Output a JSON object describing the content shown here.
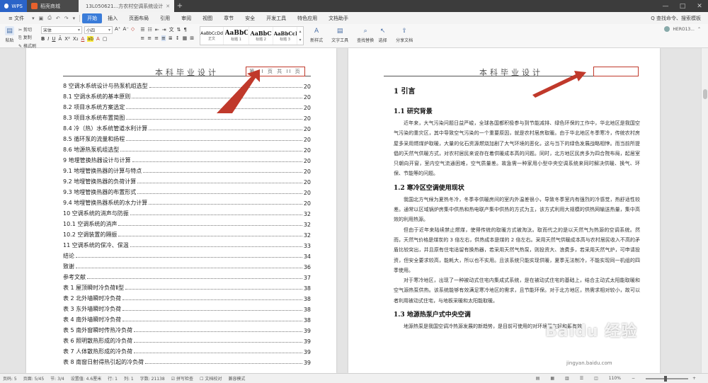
{
  "titlebar": {
    "tabs": [
      {
        "label": "WPS"
      },
      {
        "label": "稻壳商城"
      },
      {
        "label": "13L050621...方农村空调系统设计"
      }
    ],
    "add": "+",
    "controls": [
      "—",
      "□",
      "✕"
    ]
  },
  "menubar": {
    "file": "≡ 文件",
    "quick": [
      "▾",
      "▣",
      "⎙",
      "↶",
      "↷",
      "▾"
    ],
    "items": [
      "开始",
      "插入",
      "页面布局",
      "引用",
      "审阅",
      "视图",
      "章节",
      "安全",
      "开发工具",
      "特色应用",
      "文档助手"
    ],
    "active": "开始",
    "search": "Q 查找命令、搜索模板"
  },
  "ribbon": {
    "paste": "粘贴",
    "cut": "剪切",
    "copy": "复制",
    "format_painter": "格式刷",
    "font_name": "宋体",
    "font_size": "小四",
    "styles": [
      {
        "sample": "AaBbCcDd",
        "label": "正文"
      },
      {
        "sample": "AaBbC",
        "label": "标题 1"
      },
      {
        "sample": "AaBbC",
        "label": "标题 2"
      },
      {
        "sample": "AaBbCcI",
        "label": "标题 3"
      }
    ],
    "new_style": "新样式",
    "text_tools": "文字工具",
    "find_replace": "查找替换",
    "select": "选择",
    "share": "分享文档",
    "user": "HERO13..."
  },
  "left_page": {
    "header_title": "本科毕业设计",
    "page_box": "第 II 页 共 II 页",
    "toc": [
      {
        "text": "8  空调水系统设计与热泵机组选型",
        "page": "20"
      },
      {
        "text": "8.1  空调水系统的基本原则",
        "page": "20"
      },
      {
        "text": "8.2  项目水系统方案选定",
        "page": "20"
      },
      {
        "text": "8.3  项目水系统布置简图",
        "page": "20"
      },
      {
        "text": "8.4  冷（热）水系统管道水利计算",
        "page": "20"
      },
      {
        "text": "8.5  循环泵的流量和扬程",
        "page": "20"
      },
      {
        "text": "8.6  地源热泵机组选型",
        "page": "20"
      },
      {
        "text": "9  地埋管换热器设计与计算",
        "page": "20"
      },
      {
        "text": "9.1  地埋管换热器的计算与特点",
        "page": "20"
      },
      {
        "text": "9.2  地埋管换热器的负荷计算",
        "page": "20"
      },
      {
        "text": "9.3  地埋管换热器的布置形式",
        "page": "20"
      },
      {
        "text": "9.4  地埋管换热器系统的水力计算",
        "page": "20"
      },
      {
        "text": "10  空调系统的消声与防振",
        "page": "32"
      },
      {
        "text": "10.1  空调系统的消声",
        "page": "32"
      },
      {
        "text": "10.2  空调装置的隔振",
        "page": "32"
      },
      {
        "text": "11  空调系统的保冷、保温",
        "page": "33"
      },
      {
        "text": "结论",
        "page": "34"
      },
      {
        "text": "致谢",
        "page": "36"
      },
      {
        "text": "参考文献",
        "page": "37"
      },
      {
        "text": "表 1  屋顶瞬时冷负荷Ⅱ型",
        "page": "38"
      },
      {
        "text": "表 2  北外墙瞬时冷负荷",
        "page": "38"
      },
      {
        "text": "表 3  东外墙瞬时冷负荷",
        "page": "38"
      },
      {
        "text": "表 4  南外墙瞬时冷负荷",
        "page": "38"
      },
      {
        "text": "表 5  南外窗瞬时传热冷负荷",
        "page": "39"
      },
      {
        "text": "表 6  照明散热形成的冷负荷",
        "page": "39"
      },
      {
        "text": "表 7  人体散热形成的冷负荷",
        "page": "39"
      },
      {
        "text": "表 8  南窗日射得热引起的冷负荷",
        "page": "39"
      }
    ]
  },
  "right_page": {
    "header_title": "本科毕业设计",
    "h1": "1  引言",
    "sections": [
      {
        "heading": "1.1  研究背景",
        "paragraphs": [
          "近年来，大气污染问题日益严峻，全球各国都积极参与到节能减排、绿色环保的工作中，华北地区是我国空气污染的重灾区，其中导致空气污染的一个重要原因，就是农村居房取暖。由于华北地区冬季寒冷，传统农村房屋多采用燃煤炉取暖，大量的化石资源燃烧加剧了大气环境的恶化，这与当下的绿色发展战略相悖。而当前所提倡的天然气供暖方式，对农村居民来说存在着供暖成本高的问题。同时，北方地区民房多为四合院布局，起居室只朝向开窗，室内空气流通困难，空气质量差。故急需一种家用小型中央空调系统来同时解决供暖、换气、环保、节能等的问题。"
        ]
      },
      {
        "heading": "1.2  寒冷区空调使用现状",
        "paragraphs": [
          "我国北方气候为夏热冬冷，冬季非供暖房间的室内外温差很小，导致冬季室内有强烈的冷感觉，热舒适性较差。通常以区域锅炉房集中供热和热电联产集中供热的方式为主，该方式利用大规模的供热网输送热量，集中高效的利用热源。",
          "但由于近年来陆续禁止燃煤，使得传统的取暖方式被淘汰。取而代之的是以天然气为热源的空调系统。然而，天然气价格是煤炭的 3 倍左右，供热成本是煤的 2 倍左右。采用天然气供暖成本高与农村居民收入不高的矛盾比较突出，并且原有住宅适留有换热器，若采用天然气热泵，则投资大、浪费多，若采用天然气炉，可申请投资，但安全要求较高，能耗大，所以也不实用。且该系统只能实现供暖，夏季无法制冷，不能实现同一机组的四季使用。",
          "对于寒冷地区，出现了一种被动式住宅内集成式系统，是在被动式住宅的基础上，结合主动式太阳能取暖和空气源热泵供热。该系统能够有效满足寒冷地区的需求，且节能环保。对于北方地区，热需求相对较小，故可以者利用被动式住宅，与地板采暖和太阳能取暖。"
        ]
      },
      {
        "heading": "1.3  地源热泵户式中央空调",
        "paragraphs": [
          "地源热泵是我国空调冷热源发展的新趋势，是目前可使用的对环境最友好和最有效"
        ]
      }
    ]
  },
  "watermark": {
    "logo": "Baidu 经验",
    "url": "jingyan.baidu.com"
  },
  "statusbar": {
    "items": [
      "页码: 5",
      "页面: 5/45",
      "节: 3/4",
      "设置值: 4.6厘米",
      "行: 1",
      "列: 1",
      "字数: 21138",
      "☑ 拼写检查",
      "☐ 文档校对",
      "兼容模式"
    ],
    "zoom": "110%",
    "icons": [
      "▤",
      "▦",
      "▥",
      "☰",
      "◫"
    ]
  },
  "colors": {
    "titlebar": "#3c3c3c",
    "accent": "#3a7cd9",
    "annotation": "#c0392b"
  }
}
